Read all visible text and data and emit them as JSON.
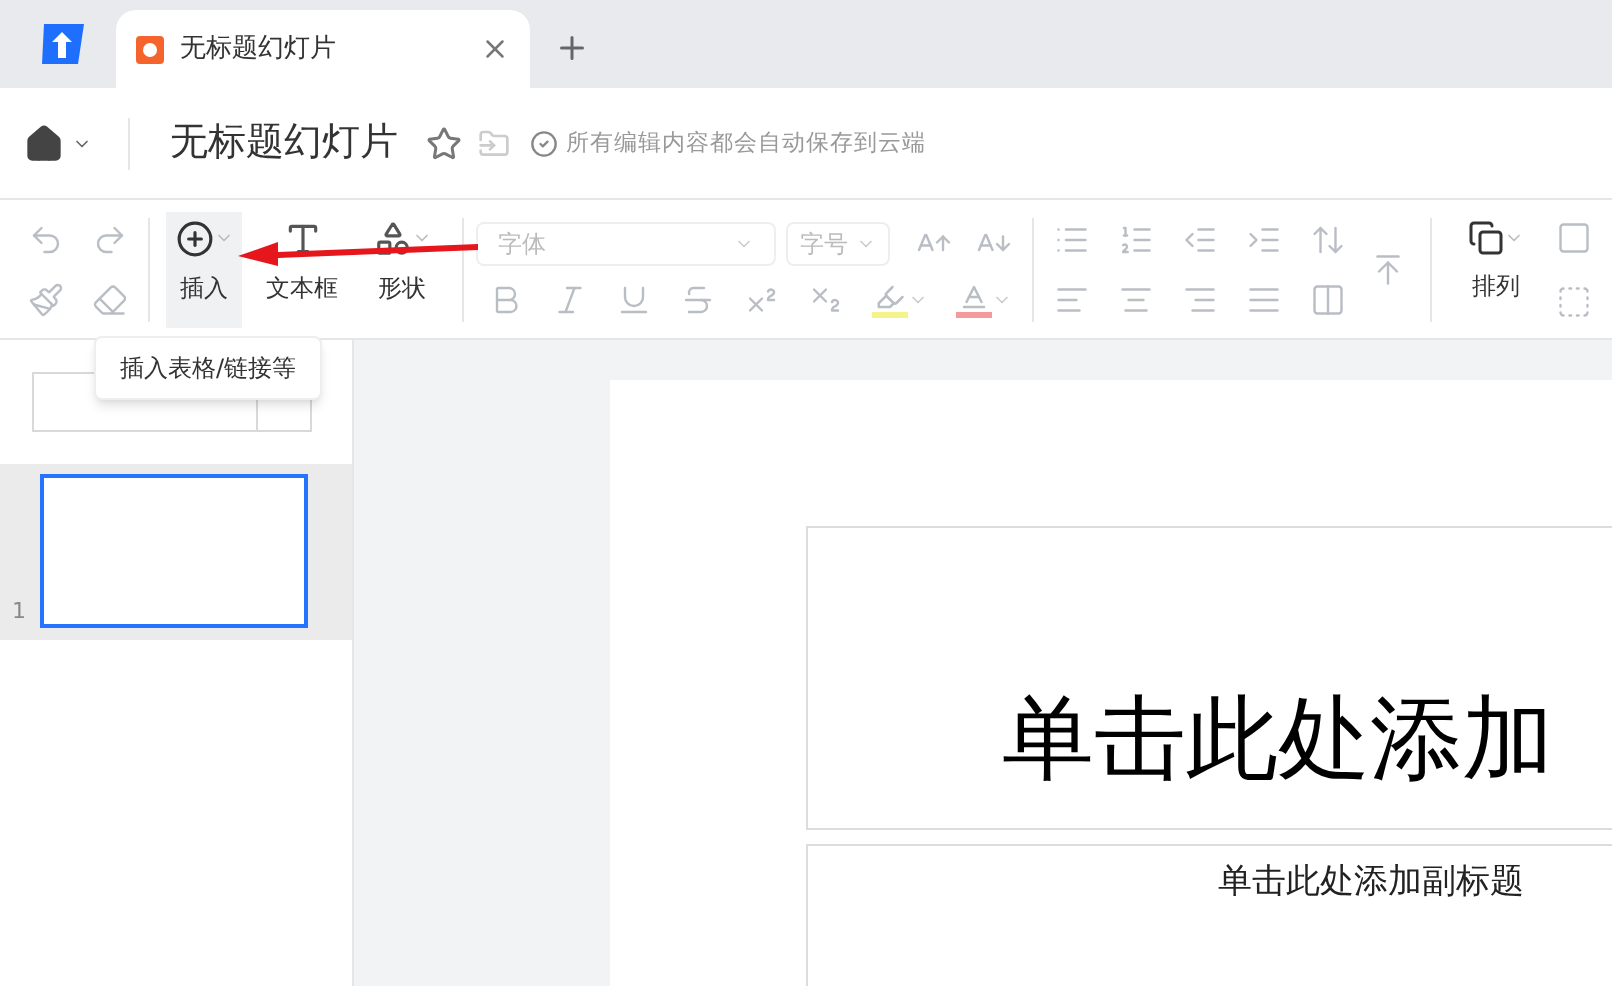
{
  "tabs": [
    {
      "title": "无标题幻灯片",
      "selected": true
    }
  ],
  "header": {
    "title": "无标题幻灯片",
    "save_status": "所有编辑内容都会自动保存到云端"
  },
  "toolbar": {
    "insert": {
      "label": "插入",
      "selected": true
    },
    "textbox": "文本框",
    "shape": "形状",
    "font_placeholder": "字体",
    "size_placeholder": "字号",
    "arrange": "排列"
  },
  "tooltip": "插入表格/链接等",
  "slides": [
    {
      "number": "1",
      "selected": true
    }
  ],
  "slide": {
    "title": "单击此处添加",
    "subtitle": "单击此处添加副标题"
  }
}
